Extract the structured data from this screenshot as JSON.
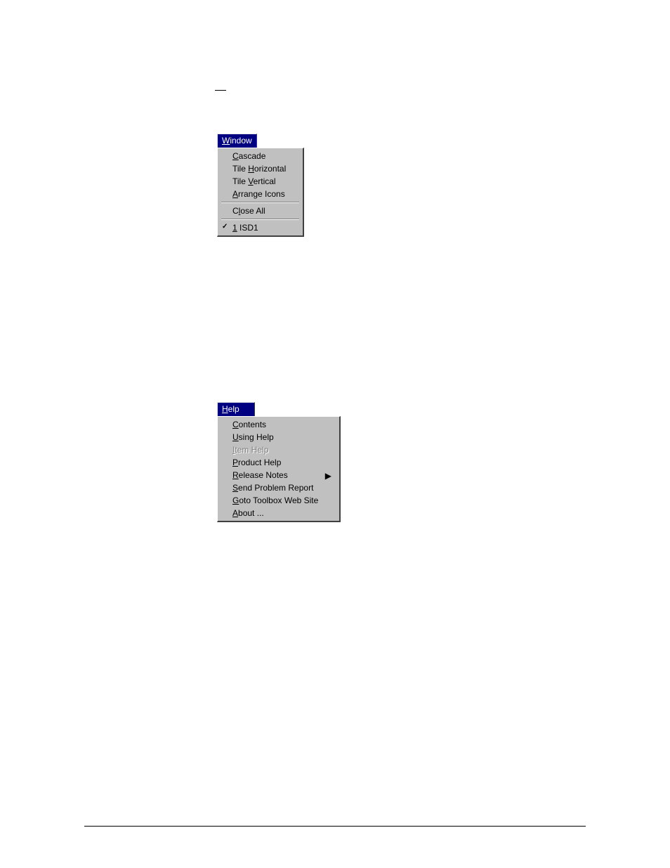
{
  "window_menu": {
    "title_pre": "",
    "title_acc": "W",
    "title_post": "indow",
    "items": [
      {
        "pre": "",
        "acc": "C",
        "post": "ascade",
        "checked": false,
        "disabled": false
      },
      {
        "pre": "Tile ",
        "acc": "H",
        "post": "orizontal",
        "checked": false,
        "disabled": false
      },
      {
        "pre": "Tile ",
        "acc": "V",
        "post": "ertical",
        "checked": false,
        "disabled": false
      },
      {
        "pre": "",
        "acc": "A",
        "post": "rrange Icons",
        "checked": false,
        "disabled": false
      },
      {
        "separator": true
      },
      {
        "pre": "C",
        "acc": "l",
        "post": "ose All",
        "checked": false,
        "disabled": false
      },
      {
        "separator": true
      },
      {
        "pre": "",
        "acc": "1",
        "post": " ISD1",
        "checked": true,
        "disabled": false
      }
    ]
  },
  "help_menu": {
    "title_pre": "",
    "title_acc": "H",
    "title_post": "elp",
    "items": [
      {
        "pre": "",
        "acc": "C",
        "post": "ontents",
        "checked": false,
        "disabled": false
      },
      {
        "pre": "",
        "acc": "U",
        "post": "sing Help",
        "checked": false,
        "disabled": false
      },
      {
        "pre": "",
        "acc": "I",
        "post": "tem Help",
        "checked": false,
        "disabled": true
      },
      {
        "pre": "",
        "acc": "P",
        "post": "roduct Help",
        "checked": false,
        "disabled": false
      },
      {
        "pre": "",
        "acc": "R",
        "post": "elease Notes",
        "checked": false,
        "disabled": false,
        "submenu": true
      },
      {
        "pre": "",
        "acc": "S",
        "post": "end Problem Report",
        "checked": false,
        "disabled": false
      },
      {
        "pre": "",
        "acc": "G",
        "post": "oto Toolbox Web Site",
        "checked": false,
        "disabled": false
      },
      {
        "pre": "",
        "acc": "A",
        "post": "bout ...",
        "checked": false,
        "disabled": false
      }
    ]
  },
  "footer": {
    "left": "",
    "right": ""
  }
}
